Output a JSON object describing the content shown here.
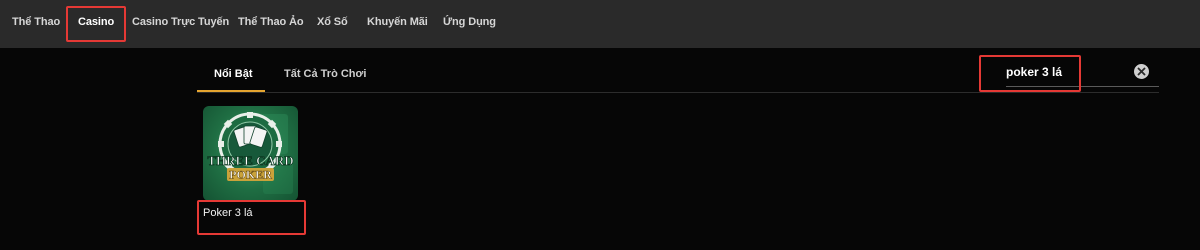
{
  "topnav": {
    "items": [
      {
        "label": "Thể Thao"
      },
      {
        "label": "Casino"
      },
      {
        "label": "Casino Trực Tuyến"
      },
      {
        "label": "Thể Thao Ảo"
      },
      {
        "label": "Xổ Số"
      },
      {
        "label": "Khuyến Mãi"
      },
      {
        "label": "Ứng Dụng"
      }
    ],
    "active": "Casino"
  },
  "tabs": [
    {
      "label": "Nổi Bật"
    },
    {
      "label": "Tất Cả Trò Chơi"
    }
  ],
  "active_tab": "Nổi Bật",
  "search": {
    "value": "poker 3 lá"
  },
  "results": [
    {
      "name": "Poker 3 lá",
      "thumbnail_text": "THREE CARD POKER"
    }
  ],
  "colors": {
    "nav_bg": "#2a2a2a",
    "page_bg": "#060606",
    "tab_accent": "#e5a530",
    "highlight": "#e53935",
    "thumb_green": "#1f6e43"
  },
  "icons": [
    "clear-icon",
    "poker-chip-icon"
  ]
}
